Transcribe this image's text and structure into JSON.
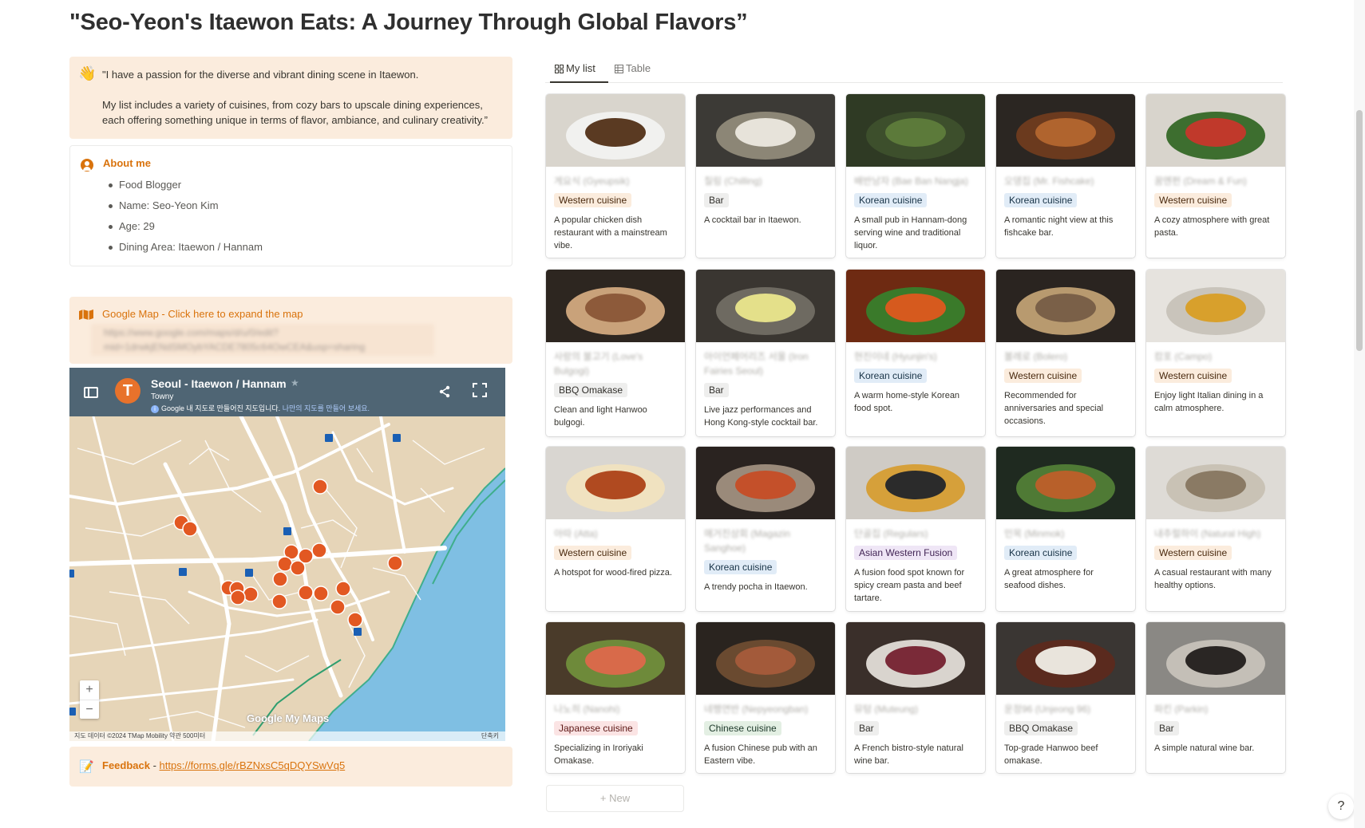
{
  "page": {
    "title": "\"Seo-Yeon's Itaewon Eats: A Journey Through Global Flavors”"
  },
  "intro": {
    "emoji": "👋",
    "line1": "\"I have a passion for the diverse and vibrant dining scene in Itaewon.",
    "line2": "My list includes a variety of cuisines, from cozy bars to upscale dining experiences, each offering something unique in terms of flavor, ambiance, and culinary creativity.”"
  },
  "about": {
    "title": "About me",
    "items": [
      "Food Blogger",
      "Name: Seo-Yeon Kim",
      "Age: 29",
      "Dining Area: Itaewon / Hannam"
    ]
  },
  "map_link": {
    "title": "Google Map - Click here to expand the map",
    "url": "https://www.google.com/maps/d/u/0/edit?mid=1drwkjENdSMOybYACDE7805c64OwCEA&usp=sharing"
  },
  "map": {
    "name": "Seoul - Itaewon / Hannam",
    "logo_letter": "T",
    "subtitle": "Towny",
    "notice": "Google 내 지도로 만들어진 지도입니다.",
    "notice_link": "나만의 지도를 만들어 보세요.",
    "zoom_in": "+",
    "zoom_out": "−",
    "google_mark": "Google My Maps",
    "footer": "지도 데이터 ©2024 TMap Mobility   약관   500미터",
    "shortcuts": "단축키"
  },
  "feedback": {
    "label": "Feedback",
    "separator": " - ",
    "url": "https://forms.gle/rBZNxsC5qDQYSwVq5"
  },
  "tabs": [
    {
      "label": "My list",
      "icon": "gallery-icon",
      "active": true
    },
    {
      "label": "Table",
      "icon": "table-icon",
      "active": false
    }
  ],
  "tag_colors": {
    "Western cuisine": {
      "bg": "#fbecdd",
      "fg": "#49290e"
    },
    "Bar": {
      "bg": "#eeeeed",
      "fg": "#32302c"
    },
    "Korean cuisine": {
      "bg": "#e1ecf7",
      "fg": "#183347"
    },
    "BBQ Omakase": {
      "bg": "#eeeeed",
      "fg": "#32302c"
    },
    "Asian Western Fusion": {
      "bg": "#efe6f6",
      "fg": "#412454"
    },
    "Japanese cuisine": {
      "bg": "#fbe4e4",
      "fg": "#5d1715"
    },
    "Chinese cuisine": {
      "bg": "#e3efe3",
      "fg": "#1c3829"
    }
  },
  "restaurants": [
    {
      "name": "게요식 (Gyeupsik)",
      "tag": "Western cuisine",
      "desc": "A popular chicken dish restaurant with a mainstream vibe."
    },
    {
      "name": "칠링 (Chilling)",
      "tag": "Bar",
      "desc": "A cocktail bar in Itaewon."
    },
    {
      "name": "배반낭자 (Bae Ban Nangja)",
      "tag": "Korean cuisine",
      "desc": "A small pub in Hannam-dong serving wine and traditional liquor."
    },
    {
      "name": "오뎅집 (Mr. Fishcake)",
      "tag": "Korean cuisine",
      "desc": "A romantic night view at this fishcake bar."
    },
    {
      "name": "꿈엔펀 (Dream & Fun)",
      "tag": "Western cuisine",
      "desc": "A cozy atmosphere with great pasta."
    },
    {
      "name": "사랑의 불고기 (Love's Bulgogi)",
      "tag": "BBQ Omakase",
      "desc": "Clean and light Hanwoo bulgogi."
    },
    {
      "name": "아이언페어리즈 서울 (Iron Fairies Seoul)",
      "tag": "Bar",
      "desc": "Live jazz performances and Hong Kong-style cocktail bar."
    },
    {
      "name": "현진이네 (Hyunjin's)",
      "tag": "Korean cuisine",
      "desc": "A warm home-style Korean food spot."
    },
    {
      "name": "볼레로 (Bolero)",
      "tag": "Western cuisine",
      "desc": "Recommended for anniversaries and special occasions."
    },
    {
      "name": "캄포 (Campo)",
      "tag": "Western cuisine",
      "desc": "Enjoy light Italian dining in a calm atmosphere."
    },
    {
      "name": "아따 (Atta)",
      "tag": "Western cuisine",
      "desc": "A hotspot for wood-fired pizza."
    },
    {
      "name": "매거진상회 (Magazin Sanghoe)",
      "tag": "Korean cuisine",
      "desc": "A trendy pocha in Itaewon."
    },
    {
      "name": "단골집 (Regulars)",
      "tag": "Asian Western Fusion",
      "desc": "A fusion food spot known for spicy cream pasta and beef tartare."
    },
    {
      "name": "민목 (Minmok)",
      "tag": "Korean cuisine",
      "desc": "A great atmosphere for seafood dishes."
    },
    {
      "name": "내추럴하이 (Natural High)",
      "tag": "Western cuisine",
      "desc": "A casual restaurant with many healthy options."
    },
    {
      "name": "나노히 (Nanohi)",
      "tag": "Japanese cuisine",
      "desc": "Specializing in Iroriyaki Omakase."
    },
    {
      "name": "네펭연반 (Nepyeongban)",
      "tag": "Chinese cuisine",
      "desc": "A fusion Chinese pub with an Eastern vibe."
    },
    {
      "name": "뮤텅 (Muteung)",
      "tag": "Bar",
      "desc": "A French bistro-style natural wine bar."
    },
    {
      "name": "운정96 (Unjeong 96)",
      "tag": "BBQ Omakase",
      "desc": "Top-grade Hanwoo beef omakase."
    },
    {
      "name": "파킨 (Parkin)",
      "tag": "Bar",
      "desc": "A simple natural wine bar."
    }
  ],
  "new_button": "+ New",
  "help": "?"
}
